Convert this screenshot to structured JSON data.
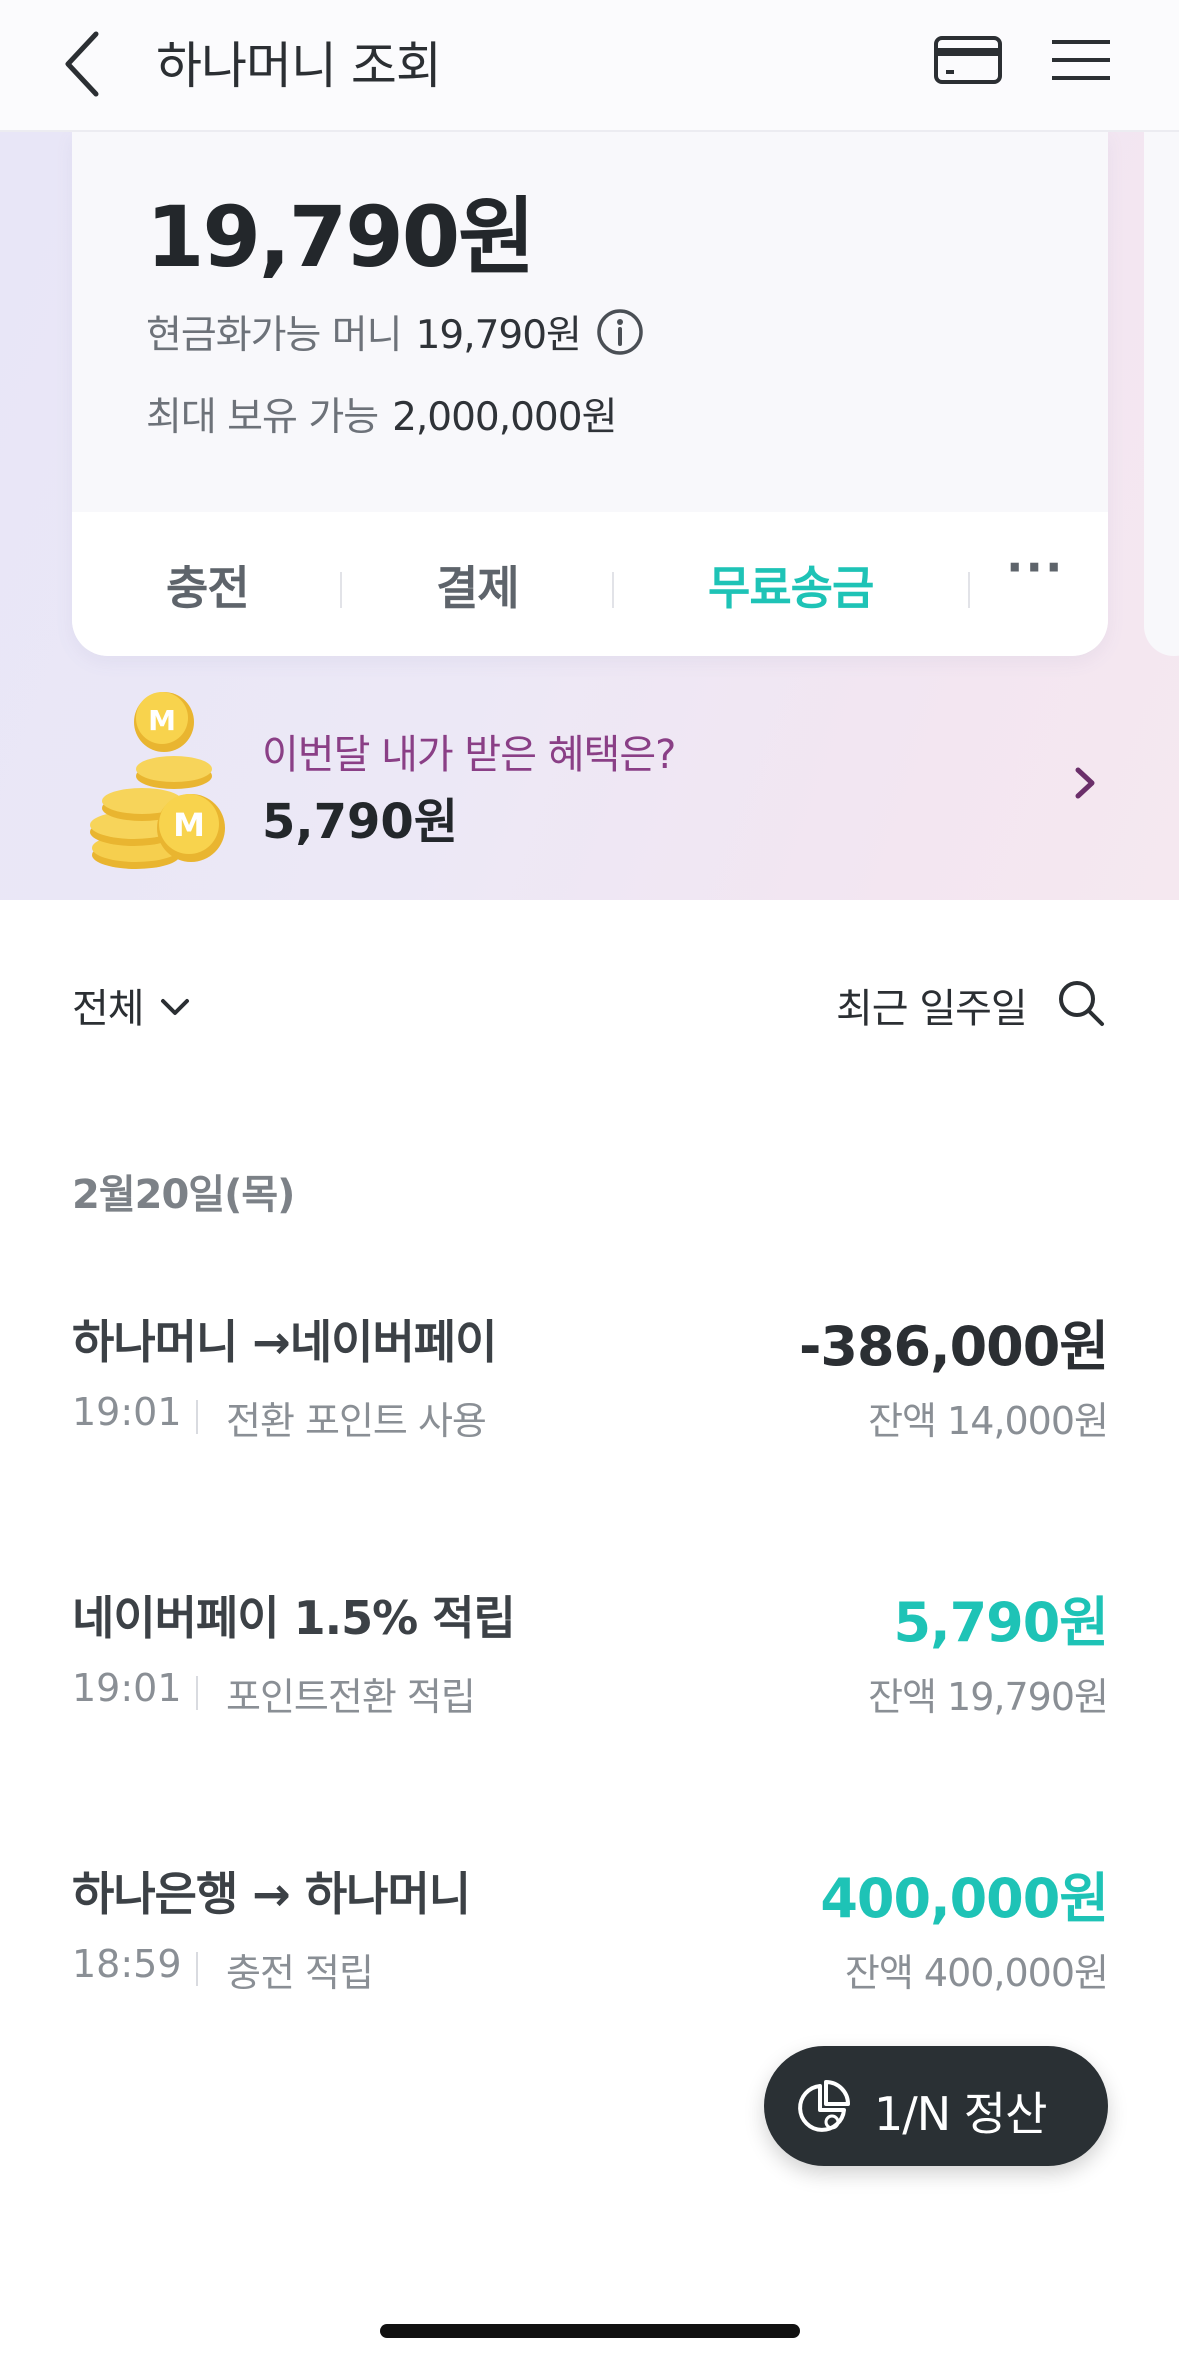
{
  "header": {
    "title": "하나머니 조회",
    "back_icon": "chevron-left-icon",
    "card_icon": "card-icon",
    "menu_icon": "hamburger-menu-icon"
  },
  "balance": {
    "amount": "19,790원",
    "cashable_label": "현금화가능 머니",
    "cashable_value": "19,790원",
    "max_label": "최대 보유 가능",
    "max_value": "2,000,000원"
  },
  "actions": {
    "charge": "충전",
    "pay": "결제",
    "free_transfer": "무료송금",
    "more": "···"
  },
  "benefit": {
    "title": "이번달 내가 받은 혜택은?",
    "amount": "5,790원"
  },
  "filter": {
    "category": "전체",
    "period": "최근 일주일"
  },
  "date_group": "2월20일(목)",
  "transactions": [
    {
      "title": "하나머니 →네이버페이",
      "time": "19:01",
      "desc": "전환 포인트 사용",
      "amount": "-386,000원",
      "balance": "잔액 14,000원"
    },
    {
      "title": "네이버페이 1.5% 적립",
      "time": "19:01",
      "desc": "포인트전환 적립",
      "amount": "5,790원",
      "balance": "잔액 19,790원"
    },
    {
      "title": "하나은행 → 하나머니",
      "time": "18:59",
      "desc": "충전 적립",
      "amount": "400,000원",
      "balance": "잔액 400,000원"
    }
  ],
  "fab": {
    "label": "1/N 정산"
  },
  "colors": {
    "accent": "#1ec3b6",
    "benefit_text": "#8a3f86",
    "dark": "#23272b",
    "negative_amount": "#2b2f33"
  }
}
